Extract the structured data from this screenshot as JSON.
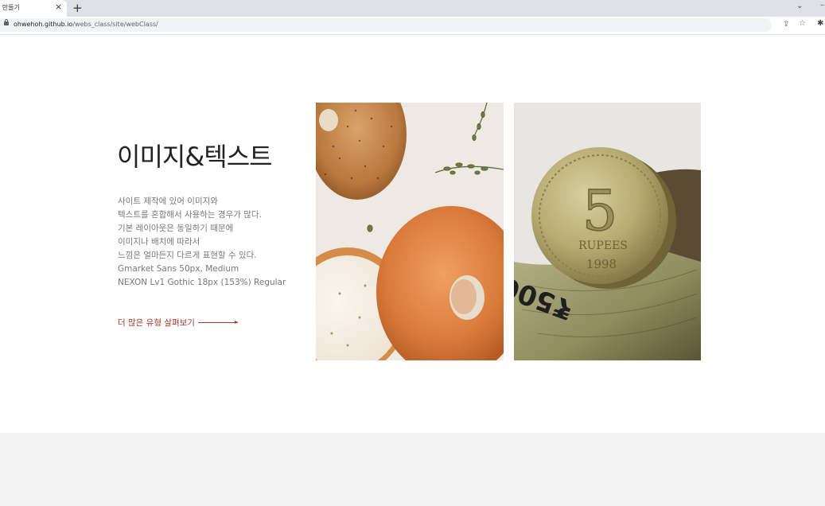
{
  "browser": {
    "tab_title": "I 만들기",
    "tab_close": "×",
    "new_tab": "+",
    "url_host": "ohwehoh.github.io",
    "url_path": "/webs_class/site/webClass/"
  },
  "section": {
    "title": "이미지&텍스트",
    "description_lines": [
      "사이트 제작에 있어 이미지와",
      "텍스트를 혼합해서 사용하는 경우가 많다.",
      "기본 레이아웃은 동일하기 때문에",
      "이미지나 배치에 따라서",
      "느낌은 얼마든지 다르게 표현할 수 있다.",
      "Gmarket Sans 50px, Medium",
      "NEXON Lv1 Gothic 18px (153%) Regular"
    ],
    "more_link": "더 많은 유형 살펴보기"
  },
  "images": {
    "bagel_text": "",
    "coin_denomination": "5",
    "coin_label": "RUPEES",
    "coin_year": "1998",
    "banknote_text": "₹500"
  },
  "colors": {
    "accent": "#a03a2c",
    "title": "#222222",
    "body_text": "#777777",
    "footer_band": "#f4f4f4"
  },
  "icons": [
    "lock-icon",
    "share-icon",
    "star-icon",
    "extensions-icon",
    "chevron-down-icon",
    "close-icon",
    "plus-icon"
  ]
}
